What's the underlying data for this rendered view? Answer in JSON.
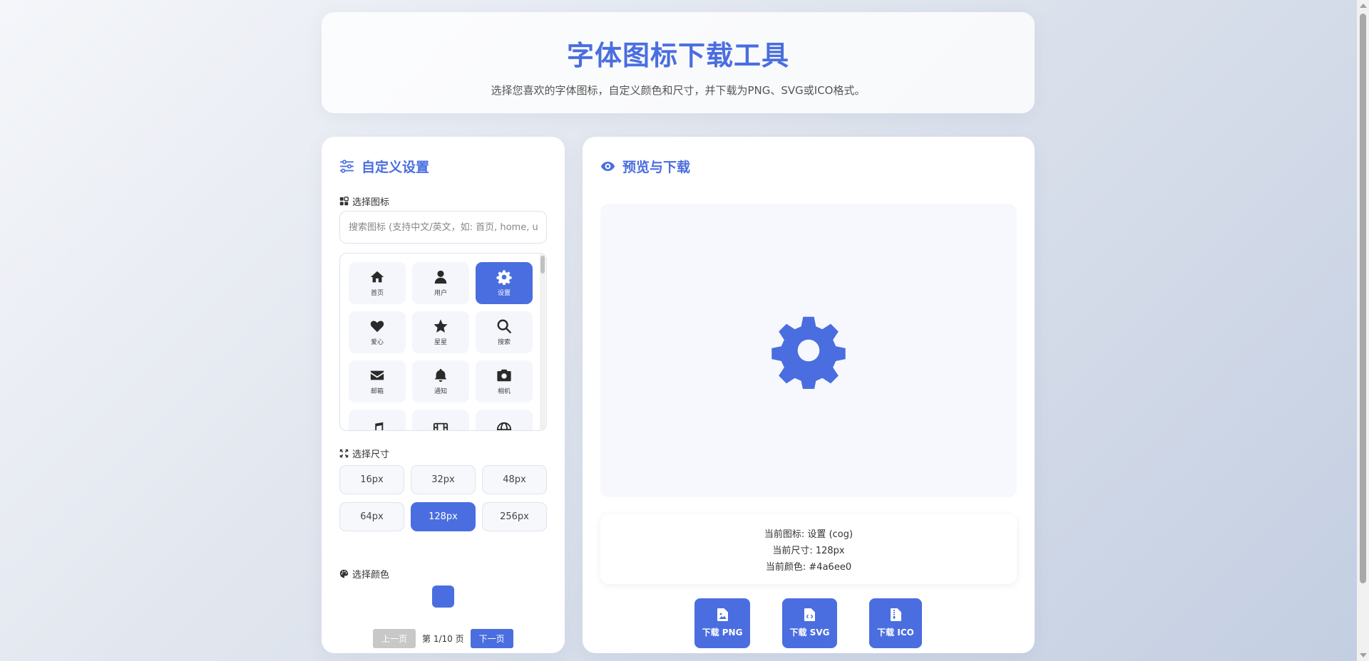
{
  "header": {
    "title": "字体图标下载工具",
    "subtitle": "选择您喜欢的字体图标，自定义颜色和尺寸，并下载为PNG、SVG或ICO格式。"
  },
  "settings": {
    "title": "自定义设置",
    "icon_section_label": "选择图标",
    "search_placeholder": "搜索图标 (支持中文/英文，如: 首页, home, u",
    "icons": [
      {
        "label": "首页",
        "icon": "home-icon"
      },
      {
        "label": "用户",
        "icon": "user-icon"
      },
      {
        "label": "设置",
        "icon": "gear-icon",
        "selected": true
      },
      {
        "label": "爱心",
        "icon": "heart-icon"
      },
      {
        "label": "星星",
        "icon": "star-icon"
      },
      {
        "label": "搜索",
        "icon": "search-icon"
      },
      {
        "label": "邮箱",
        "icon": "envelope-icon"
      },
      {
        "label": "通知",
        "icon": "bell-icon"
      },
      {
        "label": "相机",
        "icon": "camera-icon"
      },
      {
        "label": "",
        "icon": "music-icon"
      },
      {
        "label": "",
        "icon": "film-icon"
      },
      {
        "label": "",
        "icon": "globe-icon"
      }
    ],
    "size_section_label": "选择尺寸",
    "sizes": [
      "16px",
      "32px",
      "48px",
      "64px",
      "128px",
      "256px"
    ],
    "selected_size": "128px",
    "color_section_label": "选择颜色",
    "selected_color": "#4a6ee0",
    "pagination": {
      "prev_label": "上一页",
      "page_info": "第 1/10 页",
      "next_label": "下一页"
    }
  },
  "preview": {
    "title": "预览与下载",
    "current_icon": "当前图标: 设置 (cog)",
    "current_size": "当前尺寸: 128px",
    "current_color": "当前颜色: #4a6ee0",
    "download_png": "下载 PNG",
    "download_svg": "下载 SVG",
    "download_ico": "下载 ICO"
  },
  "colors": {
    "accent": "#4a6ee0"
  }
}
